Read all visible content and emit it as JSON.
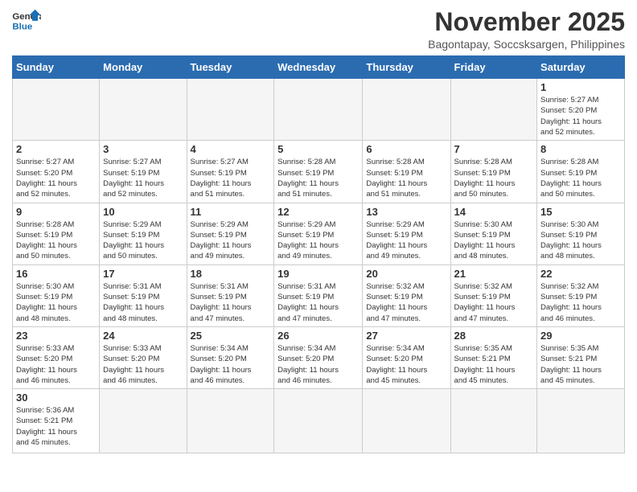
{
  "header": {
    "logo_general": "General",
    "logo_blue": "Blue",
    "month_title": "November 2025",
    "subtitle": "Bagontapay, Soccsksargen, Philippines"
  },
  "days_of_week": [
    "Sunday",
    "Monday",
    "Tuesday",
    "Wednesday",
    "Thursday",
    "Friday",
    "Saturday"
  ],
  "weeks": [
    [
      {
        "day": "",
        "info": ""
      },
      {
        "day": "",
        "info": ""
      },
      {
        "day": "",
        "info": ""
      },
      {
        "day": "",
        "info": ""
      },
      {
        "day": "",
        "info": ""
      },
      {
        "day": "",
        "info": ""
      },
      {
        "day": "1",
        "info": "Sunrise: 5:27 AM\nSunset: 5:20 PM\nDaylight: 11 hours\nand 52 minutes."
      }
    ],
    [
      {
        "day": "2",
        "info": "Sunrise: 5:27 AM\nSunset: 5:20 PM\nDaylight: 11 hours\nand 52 minutes."
      },
      {
        "day": "3",
        "info": "Sunrise: 5:27 AM\nSunset: 5:19 PM\nDaylight: 11 hours\nand 52 minutes."
      },
      {
        "day": "4",
        "info": "Sunrise: 5:27 AM\nSunset: 5:19 PM\nDaylight: 11 hours\nand 51 minutes."
      },
      {
        "day": "5",
        "info": "Sunrise: 5:28 AM\nSunset: 5:19 PM\nDaylight: 11 hours\nand 51 minutes."
      },
      {
        "day": "6",
        "info": "Sunrise: 5:28 AM\nSunset: 5:19 PM\nDaylight: 11 hours\nand 51 minutes."
      },
      {
        "day": "7",
        "info": "Sunrise: 5:28 AM\nSunset: 5:19 PM\nDaylight: 11 hours\nand 50 minutes."
      },
      {
        "day": "8",
        "info": "Sunrise: 5:28 AM\nSunset: 5:19 PM\nDaylight: 11 hours\nand 50 minutes."
      }
    ],
    [
      {
        "day": "9",
        "info": "Sunrise: 5:28 AM\nSunset: 5:19 PM\nDaylight: 11 hours\nand 50 minutes."
      },
      {
        "day": "10",
        "info": "Sunrise: 5:29 AM\nSunset: 5:19 PM\nDaylight: 11 hours\nand 50 minutes."
      },
      {
        "day": "11",
        "info": "Sunrise: 5:29 AM\nSunset: 5:19 PM\nDaylight: 11 hours\nand 49 minutes."
      },
      {
        "day": "12",
        "info": "Sunrise: 5:29 AM\nSunset: 5:19 PM\nDaylight: 11 hours\nand 49 minutes."
      },
      {
        "day": "13",
        "info": "Sunrise: 5:29 AM\nSunset: 5:19 PM\nDaylight: 11 hours\nand 49 minutes."
      },
      {
        "day": "14",
        "info": "Sunrise: 5:30 AM\nSunset: 5:19 PM\nDaylight: 11 hours\nand 48 minutes."
      },
      {
        "day": "15",
        "info": "Sunrise: 5:30 AM\nSunset: 5:19 PM\nDaylight: 11 hours\nand 48 minutes."
      }
    ],
    [
      {
        "day": "16",
        "info": "Sunrise: 5:30 AM\nSunset: 5:19 PM\nDaylight: 11 hours\nand 48 minutes."
      },
      {
        "day": "17",
        "info": "Sunrise: 5:31 AM\nSunset: 5:19 PM\nDaylight: 11 hours\nand 48 minutes."
      },
      {
        "day": "18",
        "info": "Sunrise: 5:31 AM\nSunset: 5:19 PM\nDaylight: 11 hours\nand 47 minutes."
      },
      {
        "day": "19",
        "info": "Sunrise: 5:31 AM\nSunset: 5:19 PM\nDaylight: 11 hours\nand 47 minutes."
      },
      {
        "day": "20",
        "info": "Sunrise: 5:32 AM\nSunset: 5:19 PM\nDaylight: 11 hours\nand 47 minutes."
      },
      {
        "day": "21",
        "info": "Sunrise: 5:32 AM\nSunset: 5:19 PM\nDaylight: 11 hours\nand 47 minutes."
      },
      {
        "day": "22",
        "info": "Sunrise: 5:32 AM\nSunset: 5:19 PM\nDaylight: 11 hours\nand 46 minutes."
      }
    ],
    [
      {
        "day": "23",
        "info": "Sunrise: 5:33 AM\nSunset: 5:20 PM\nDaylight: 11 hours\nand 46 minutes."
      },
      {
        "day": "24",
        "info": "Sunrise: 5:33 AM\nSunset: 5:20 PM\nDaylight: 11 hours\nand 46 minutes."
      },
      {
        "day": "25",
        "info": "Sunrise: 5:34 AM\nSunset: 5:20 PM\nDaylight: 11 hours\nand 46 minutes."
      },
      {
        "day": "26",
        "info": "Sunrise: 5:34 AM\nSunset: 5:20 PM\nDaylight: 11 hours\nand 46 minutes."
      },
      {
        "day": "27",
        "info": "Sunrise: 5:34 AM\nSunset: 5:20 PM\nDaylight: 11 hours\nand 45 minutes."
      },
      {
        "day": "28",
        "info": "Sunrise: 5:35 AM\nSunset: 5:21 PM\nDaylight: 11 hours\nand 45 minutes."
      },
      {
        "day": "29",
        "info": "Sunrise: 5:35 AM\nSunset: 5:21 PM\nDaylight: 11 hours\nand 45 minutes."
      }
    ],
    [
      {
        "day": "30",
        "info": "Sunrise: 5:36 AM\nSunset: 5:21 PM\nDaylight: 11 hours\nand 45 minutes."
      },
      {
        "day": "",
        "info": ""
      },
      {
        "day": "",
        "info": ""
      },
      {
        "day": "",
        "info": ""
      },
      {
        "day": "",
        "info": ""
      },
      {
        "day": "",
        "info": ""
      },
      {
        "day": "",
        "info": ""
      }
    ]
  ]
}
